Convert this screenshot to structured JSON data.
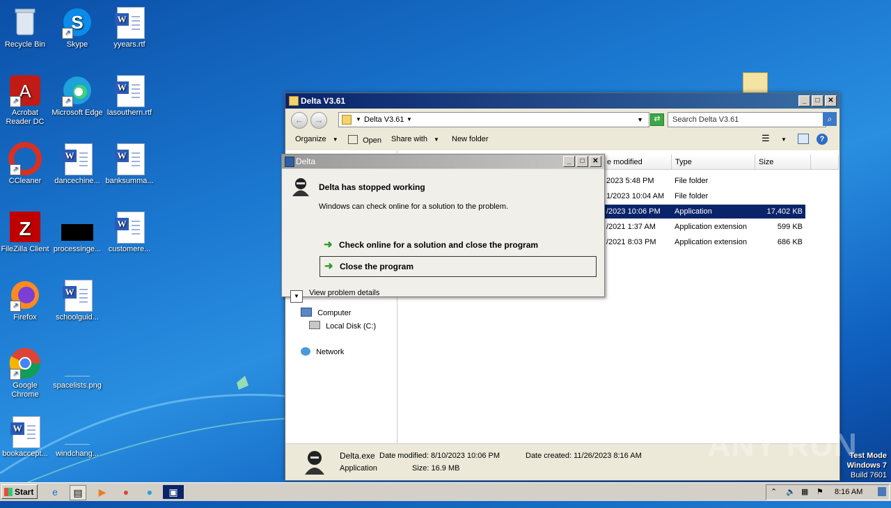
{
  "desktop": {
    "icons": [
      {
        "label": "Recycle Bin"
      },
      {
        "label": "Skype"
      },
      {
        "label": "yyears.rtf"
      },
      {
        "label": "Acrobat Reader DC"
      },
      {
        "label": "Microsoft Edge"
      },
      {
        "label": "lasouthern.rtf"
      },
      {
        "label": "CCleaner"
      },
      {
        "label": "dancechine..."
      },
      {
        "label": "banksumma..."
      },
      {
        "label": "FileZilla Client"
      },
      {
        "label": "processinge..."
      },
      {
        "label": "customere..."
      },
      {
        "label": "Firefox"
      },
      {
        "label": "schoolguid..."
      },
      {
        "label": "Google Chrome"
      },
      {
        "label": "spacelists.png"
      },
      {
        "label": "bookaccept..."
      },
      {
        "label": "windchang..."
      }
    ],
    "watermark": "ANY RUN",
    "test_mode": [
      "Test Mode",
      "Windows 7",
      "Build 7601"
    ]
  },
  "explorer": {
    "title": "Delta V3.61",
    "address": "Delta V3.61",
    "search_placeholder": "Search Delta V3.61",
    "toolbar": {
      "organize": "Organize",
      "open": "Open",
      "share_with": "Share with",
      "new_folder": "New folder"
    },
    "columns": {
      "date_modified": "e modified",
      "type": "Type",
      "size": "Size"
    },
    "rows": [
      {
        "date": "2023 5:48 PM",
        "type": "File folder",
        "size": ""
      },
      {
        "date": "1/2023 10:04 AM",
        "type": "File folder",
        "size": ""
      },
      {
        "date": "/2023 10:06 PM",
        "type": "Application",
        "size": "17,402 KB"
      },
      {
        "date": "/2021 1:37 AM",
        "type": "Application extension",
        "size": "599 KB"
      },
      {
        "date": "/2021 8:03 PM",
        "type": "Application extension",
        "size": "686 KB"
      }
    ],
    "nav": {
      "computer": "Computer",
      "local_disk": "Local Disk (C:)",
      "network": "Network"
    },
    "details": {
      "filename": "Delta.exe",
      "date_modified": "Date modified: 8/10/2023 10:06 PM",
      "date_created": "Date created: 11/26/2023 8:16 AM",
      "kind": "Application",
      "size": "Size: 16.9 MB"
    }
  },
  "dialog": {
    "title": "Delta",
    "heading": "Delta has stopped working",
    "message": "Windows can check online for a solution to the problem.",
    "option_check": "Check online for a solution and close the program",
    "option_close": "Close the program",
    "details": "View problem details"
  },
  "taskbar": {
    "start": "Start",
    "clock": "8:16 AM"
  }
}
